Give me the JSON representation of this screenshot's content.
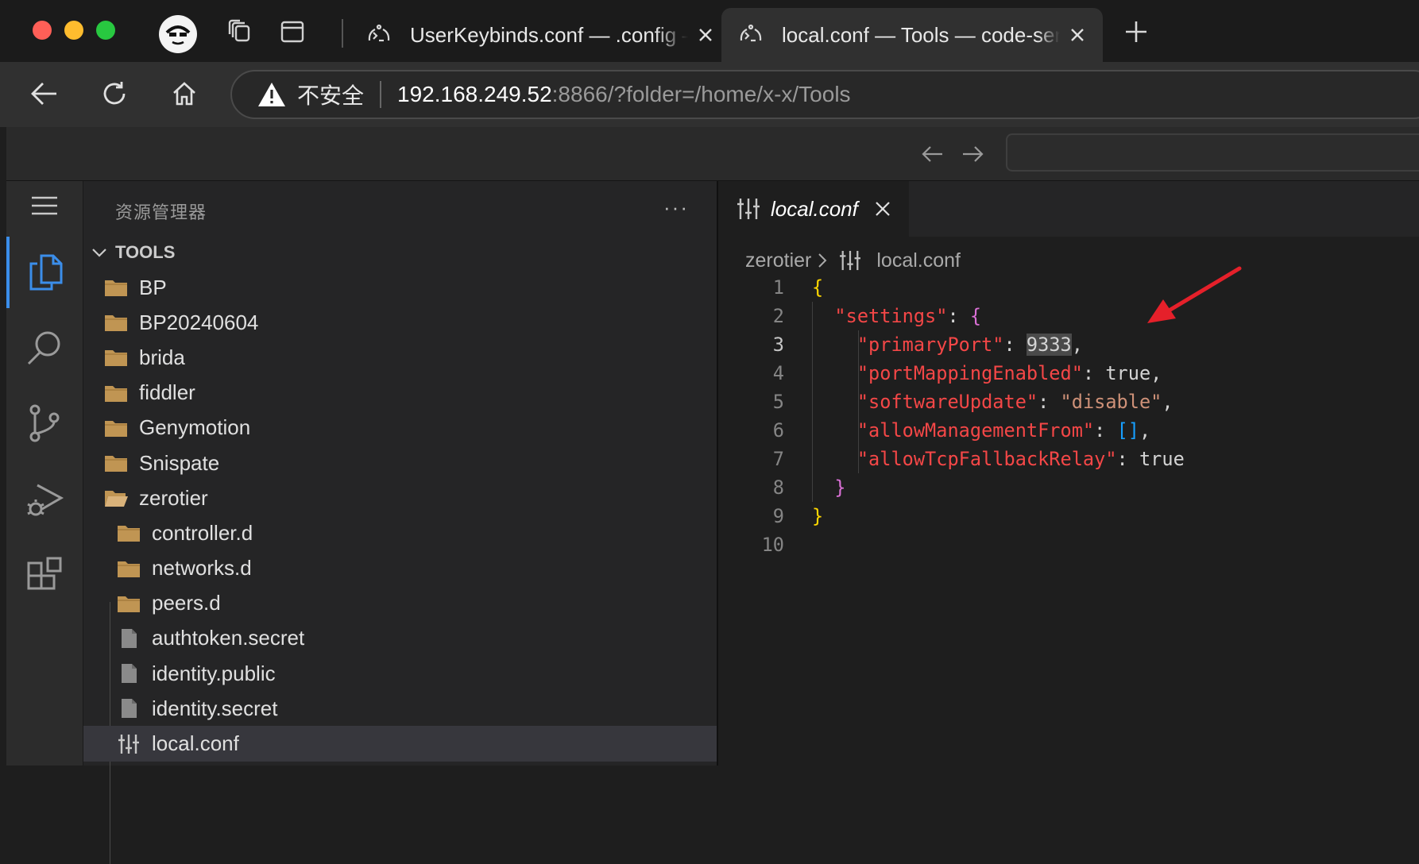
{
  "browser": {
    "tabs": [
      {
        "title": "UserKeybinds.conf — .config — code-server",
        "active": false
      },
      {
        "title": "local.conf — Tools — code-server",
        "active": true
      }
    ],
    "address": {
      "security_label": "不安全",
      "url_host": "192.168.249.52",
      "url_rest": ":8866/?folder=/home/x-x/Tools"
    }
  },
  "explorer": {
    "title": "资源管理器",
    "more": "···",
    "section": "TOOLS",
    "items": [
      {
        "label": "BP",
        "kind": "folder",
        "depth": 0
      },
      {
        "label": "BP20240604",
        "kind": "folder",
        "depth": 0
      },
      {
        "label": "brida",
        "kind": "folder",
        "depth": 0
      },
      {
        "label": "fiddler",
        "kind": "folder",
        "depth": 0
      },
      {
        "label": "Genymotion",
        "kind": "folder",
        "depth": 0
      },
      {
        "label": "Snispate",
        "kind": "folder",
        "depth": 0
      },
      {
        "label": "zerotier",
        "kind": "folder-open",
        "depth": 0
      },
      {
        "label": "controller.d",
        "kind": "folder",
        "depth": 1
      },
      {
        "label": "networks.d",
        "kind": "folder",
        "depth": 1
      },
      {
        "label": "peers.d",
        "kind": "folder",
        "depth": 1
      },
      {
        "label": "authtoken.secret",
        "kind": "file",
        "depth": 1
      },
      {
        "label": "identity.public",
        "kind": "file",
        "depth": 1
      },
      {
        "label": "identity.secret",
        "kind": "file",
        "depth": 1
      },
      {
        "label": "local.conf",
        "kind": "config",
        "depth": 1,
        "selected": true
      }
    ]
  },
  "editor": {
    "tab_label": "local.conf",
    "breadcrumb": [
      "zerotier",
      "local.conf"
    ],
    "current_line": 3,
    "lines": [
      {
        "n": "1",
        "indent": 0,
        "tokens": [
          {
            "t": "{",
            "c": "brace1"
          }
        ]
      },
      {
        "n": "2",
        "indent": 1,
        "tokens": [
          {
            "t": "\"settings\"",
            "c": "key"
          },
          {
            "t": ": ",
            "c": "plain"
          },
          {
            "t": "{",
            "c": "brace2"
          }
        ]
      },
      {
        "n": "3",
        "indent": 2,
        "tokens": [
          {
            "t": "\"primaryPort\"",
            "c": "key"
          },
          {
            "t": ": ",
            "c": "plain"
          },
          {
            "t": "9333",
            "c": "num"
          },
          {
            "t": ",",
            "c": "plain"
          }
        ]
      },
      {
        "n": "4",
        "indent": 2,
        "tokens": [
          {
            "t": "\"portMappingEnabled\"",
            "c": "key"
          },
          {
            "t": ": true,",
            "c": "plain"
          }
        ]
      },
      {
        "n": "5",
        "indent": 2,
        "tokens": [
          {
            "t": "\"softwareUpdate\"",
            "c": "key"
          },
          {
            "t": ": ",
            "c": "plain"
          },
          {
            "t": "\"disable\"",
            "c": "str"
          },
          {
            "t": ",",
            "c": "plain"
          }
        ]
      },
      {
        "n": "6",
        "indent": 2,
        "tokens": [
          {
            "t": "\"allowManagementFrom\"",
            "c": "key"
          },
          {
            "t": ": ",
            "c": "plain"
          },
          {
            "t": "[]",
            "c": "bracket"
          },
          {
            "t": ",",
            "c": "plain"
          }
        ]
      },
      {
        "n": "7",
        "indent": 2,
        "tokens": [
          {
            "t": "\"allowTcpFallbackRelay\"",
            "c": "key"
          },
          {
            "t": ": true",
            "c": "plain"
          }
        ]
      },
      {
        "n": "8",
        "indent": 1,
        "tokens": [
          {
            "t": "}",
            "c": "brace2"
          }
        ]
      },
      {
        "n": "9",
        "indent": 0,
        "tokens": [
          {
            "t": "}",
            "c": "brace1"
          }
        ]
      },
      {
        "n": "10",
        "indent": 0,
        "tokens": []
      }
    ]
  },
  "colors": {
    "accent": "#3b8eea",
    "folder": "#c09553",
    "arrow": "#e5202a"
  }
}
